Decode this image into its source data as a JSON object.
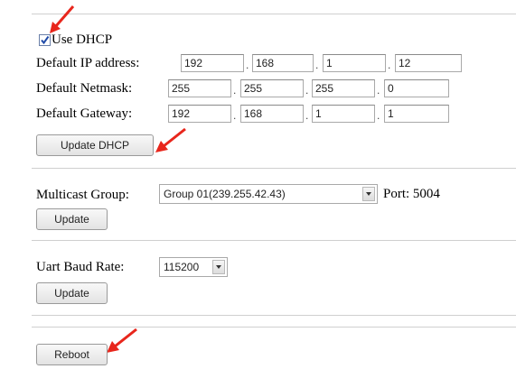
{
  "dhcp": {
    "checkbox_label": "Use DHCP",
    "checked": true,
    "ip_label": "Default IP address:",
    "ip": [
      "192",
      "168",
      "1",
      "12"
    ],
    "netmask_label": "Default Netmask:",
    "netmask": [
      "255",
      "255",
      "255",
      "0"
    ],
    "gateway_label": "Default Gateway:",
    "gateway": [
      "192",
      "168",
      "1",
      "1"
    ],
    "separator": ".",
    "update_button": "Update DHCP"
  },
  "multicast": {
    "label": "Multicast Group:",
    "selected": "Group 01(239.255.42.43)",
    "port_label": "Port: 5004",
    "update_button": "Update"
  },
  "uart": {
    "label": "Uart Baud Rate:",
    "selected": "115200",
    "update_button": "Update"
  },
  "reboot_button": "Reboot",
  "colors": {
    "annotation_arrow": "#e8261c",
    "divider": "#cfcfcf",
    "checkbox_check": "#1f4aa8"
  },
  "icons": [
    "arrow-annotation-icon",
    "chevron-down-icon",
    "checkmark-icon"
  ]
}
